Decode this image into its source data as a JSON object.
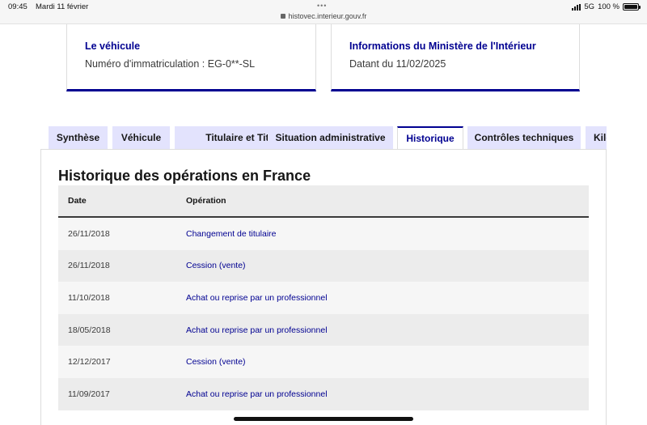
{
  "status_bar": {
    "time": "09:45",
    "date": "Mardi 11 février",
    "dots": "•••",
    "url": "histovec.interieur.gouv.fr",
    "network": "5G",
    "battery": "100 %",
    "battery_level": 1.0
  },
  "cards": {
    "vehicle": {
      "title": "Le véhicule",
      "text": "Numéro d'immatriculation : EG-0**-SL"
    },
    "ministry": {
      "title": "Informations du Ministère de l'Intérieur",
      "text": "Datant du 11/02/2025"
    }
  },
  "tabs": [
    {
      "label": "Synthèse",
      "active": false
    },
    {
      "label": "Véhicule",
      "active": false
    },
    {
      "label": "Titulaire et Titre",
      "active": false
    },
    {
      "label": "Situation administrative",
      "active": false
    },
    {
      "label": "Historique",
      "active": true
    },
    {
      "label": "Contrôles techniques",
      "active": false
    },
    {
      "label": "Kilo",
      "active": false
    }
  ],
  "history": {
    "title": "Historique des opérations en France",
    "columns": {
      "date": "Date",
      "operation": "Opération"
    },
    "rows": [
      {
        "date": "26/11/2018",
        "operation": "Changement de titulaire"
      },
      {
        "date": "26/11/2018",
        "operation": "Cession (vente)"
      },
      {
        "date": "11/10/2018",
        "operation": "Achat ou reprise par un professionnel"
      },
      {
        "date": "18/05/2018",
        "operation": "Achat ou reprise par un professionnel"
      },
      {
        "date": "12/12/2017",
        "operation": "Cession (vente)"
      },
      {
        "date": "11/09/2017",
        "operation": "Achat ou reprise par un professionnel"
      }
    ]
  },
  "colors": {
    "accent": "#000091",
    "tab_inactive": "#e3e3fd",
    "row_light": "#f6f6f6",
    "row_dark": "#ececec"
  }
}
